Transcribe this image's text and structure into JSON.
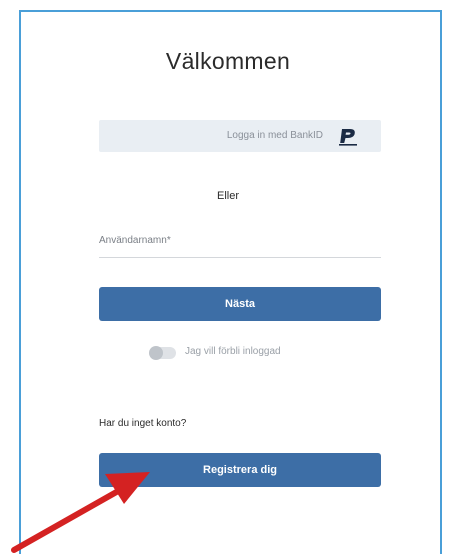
{
  "login": {
    "title": "Välkommen",
    "bankid_label": "Logga in med BankID",
    "or_text": "Eller",
    "username_label": "Användarnamn*",
    "next_label": "Nästa",
    "remember_label": "Jag vill förbli inloggad",
    "no_account_text": "Har du inget konto?",
    "register_label": "Registrera dig"
  },
  "colors": {
    "frame_border": "#4a9fd8",
    "primary_button": "#3d6ea6",
    "bankid_background": "#e9eef3",
    "annotation_arrow": "#d42222"
  },
  "icons": {
    "bankid": "bankid-logo-icon",
    "annotation": "red-arrow-icon"
  }
}
